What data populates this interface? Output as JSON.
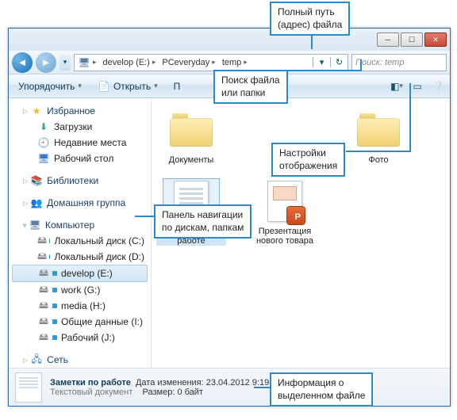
{
  "callouts": {
    "path": "Полный путь\n(адрес) файла",
    "search": "Поиск файла\nили папки",
    "view": "Настройки\nотображения",
    "navpanel": "Панель навигации\nпо дискам, папкам",
    "info": "Информация о\nвыделенном файле"
  },
  "address": {
    "drive": "develop (E:)",
    "p1": "PCeveryday",
    "p2": "temp"
  },
  "search": {
    "placeholder": "Поиск: temp"
  },
  "toolbar": {
    "organize": "Упорядочить",
    "open": "Открыть",
    "p": "П"
  },
  "nav": {
    "fav": "Избранное",
    "downloads": "Загрузки",
    "recent": "Недавние места",
    "desktop": "Рабочий стол",
    "libraries": "Библиотеки",
    "homegroup": "Домашняя группа",
    "computer": "Компьютер",
    "drives": [
      "Локальный диск (C:)",
      "Локальный диск (D:)",
      "develop (E:)",
      "work (G:)",
      "media (H:)",
      "Общие данные (I:)",
      "Рабочий (J:)"
    ],
    "network": "Сеть"
  },
  "items": {
    "docs": "Документы",
    "photo": "Фото",
    "notes": "Заметки по работе",
    "ppt": "Презентация нового товара"
  },
  "status": {
    "name": "Заметки по работе",
    "type": "Текстовый документ",
    "date_lbl": "Дата изменения:",
    "date": "23.04.2012 9:19",
    "size_lbl": "Размер:",
    "size": "0 байт"
  }
}
